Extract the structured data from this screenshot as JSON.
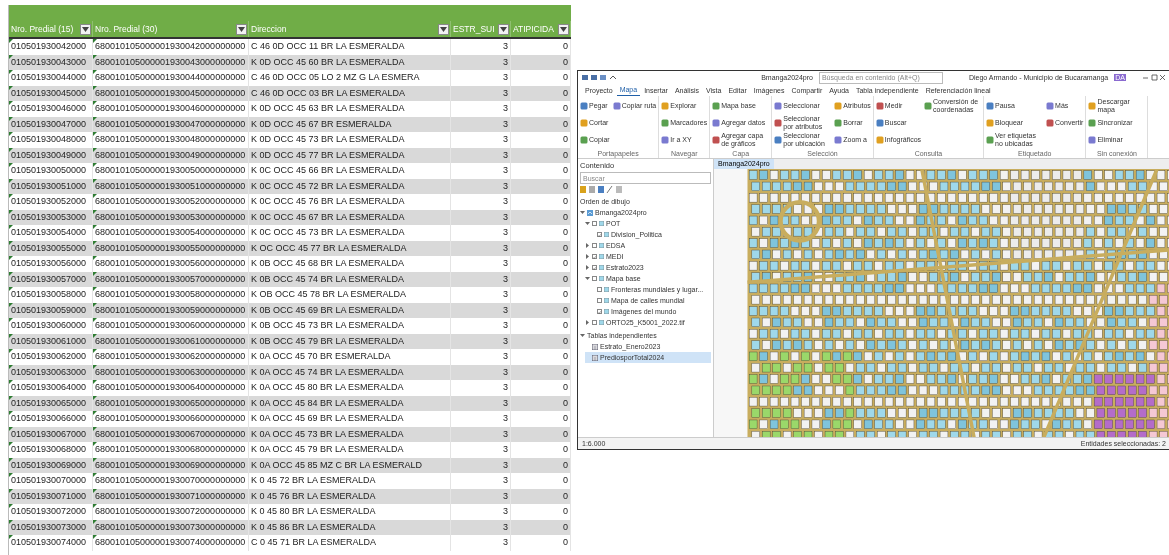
{
  "sheet": {
    "columns": [
      {
        "label": "Nro. Predial (15)"
      },
      {
        "label": "Nro. Predial (30)"
      },
      {
        "label": "Direccion"
      },
      {
        "label": "ESTR_SUI"
      },
      {
        "label": "ATIPICIDA"
      }
    ],
    "rows": [
      {
        "cells": [
          "010501930042000",
          "680010105000001930042000000000",
          "C 46 0D OCC 11 BR LA ESMERALDA",
          "3",
          "0"
        ]
      },
      {
        "cells": [
          "010501930043000",
          "680010105000001930043000000000",
          "K 0D OCC 45 60 BR LA ESMERALDA",
          "3",
          "0"
        ]
      },
      {
        "cells": [
          "010501930044000",
          "680010105000001930044000000000",
          "C 46 0D OCC 05 LO 2 MZ G LA ESMERA",
          "3",
          "0"
        ]
      },
      {
        "cells": [
          "010501930045000",
          "680010105000001930045000000000",
          "C 46 0D OCC 03 BR LA ESMERALDA",
          "3",
          "0"
        ]
      },
      {
        "cells": [
          "010501930046000",
          "680010105000001930046000000000",
          "K 0D OCC 45 63 BR LA ESMERALDA",
          "3",
          "0"
        ]
      },
      {
        "cells": [
          "010501930047000",
          "680010105000001930047000000000",
          "K 0D OCC 45 67 BR ESMERALDA",
          "3",
          "0"
        ]
      },
      {
        "cells": [
          "010501930048000",
          "680010105000001930048000000000",
          "K 0D OCC 45 73 BR LA ESMERALDA",
          "3",
          "0"
        ]
      },
      {
        "cells": [
          "010501930049000",
          "680010105000001930049000000000",
          "K 0D OCC 45 77 BR LA ESMERALDA",
          "3",
          "0"
        ]
      },
      {
        "cells": [
          "010501930050000",
          "680010105000001930050000000000",
          "K 0C OCC 45 66 BR LA ESMERALDA",
          "3",
          "0"
        ]
      },
      {
        "cells": [
          "010501930051000",
          "680010105000001930051000000000",
          "K 0C OCC 45 72 BR LA ESMERALDA",
          "3",
          "0"
        ]
      },
      {
        "cells": [
          "010501930052000",
          "680010105000001930052000000000",
          "K 0C OCC 45 76 BR LA ESMERALDA",
          "3",
          "0"
        ]
      },
      {
        "cells": [
          "010501930053000",
          "680010105000001930053000000000",
          "K 0C OCC 45 67 BR LA ESMERALDA",
          "3",
          "0"
        ]
      },
      {
        "cells": [
          "010501930054000",
          "680010105000001930054000000000",
          "K 0C OCC 45 73 BR LA ESMERALDA",
          "3",
          "0"
        ]
      },
      {
        "cells": [
          "010501930055000",
          "680010105000001930055000000000",
          "K OC OCC 45 77 BR LA ESMERALDA",
          "3",
          "0"
        ]
      },
      {
        "cells": [
          "010501930056000",
          "680010105000001930056000000000",
          "K 0B OCC 45 68 BR LA ESMERALDA",
          "3",
          "0"
        ]
      },
      {
        "cells": [
          "010501930057000",
          "680010105000001930057000000000",
          "K 0B OCC 45 74 BR LA ESMERALDA",
          "3",
          "0"
        ]
      },
      {
        "cells": [
          "010501930058000",
          "680010105000001930058000000000",
          "K OB OCC 45 78 BR LA ESMERALDA",
          "3",
          "0"
        ]
      },
      {
        "cells": [
          "010501930059000",
          "680010105000001930059000000000",
          "K 0B OCC 45 69 BR LA ESMERALDA",
          "3",
          "0"
        ]
      },
      {
        "cells": [
          "010501930060000",
          "680010105000001930060000000000",
          "K 0B OCC 45 73 BR LA ESMERALDA",
          "3",
          "0"
        ]
      },
      {
        "cells": [
          "010501930061000",
          "680010105000001930061000000000",
          "K 0B OCC 45 79 BR LA ESMERALDA",
          "3",
          "0"
        ]
      },
      {
        "cells": [
          "010501930062000",
          "680010105000001930062000000000",
          "K 0A OCC 45 70 BR ESMERALDA",
          "3",
          "0"
        ]
      },
      {
        "cells": [
          "010501930063000",
          "680010105000001930063000000000",
          "K 0A OCC 45 74 BR LA ESMERALDA",
          "3",
          "0"
        ]
      },
      {
        "cells": [
          "010501930064000",
          "680010105000001930064000000000",
          "K 0A OCC 45 80 BR LA ESMERALDA",
          "3",
          "0"
        ]
      },
      {
        "cells": [
          "010501930065000",
          "680010105000001930065000000000",
          "K 0A OCC 45 84 BR LA ESMERALDA",
          "3",
          "0"
        ]
      },
      {
        "cells": [
          "010501930066000",
          "680010105000001930066000000000",
          "K 0A OCC 45 69 BR LA ESMERALDA",
          "3",
          "0"
        ]
      },
      {
        "cells": [
          "010501930067000",
          "680010105000001930067000000000",
          "K 0A OCC 45 73 BR LA ESMERALDA",
          "3",
          "0"
        ]
      },
      {
        "cells": [
          "010501930068000",
          "680010105000001930068000000000",
          "K 0A OCC 45 79 BR LA ESMERALDA",
          "3",
          "0"
        ]
      },
      {
        "cells": [
          "010501930069000",
          "680010105000001930069000000000",
          "K 0A OCC 45 85 MZ C BR LA ESMERALD",
          "3",
          "0"
        ]
      },
      {
        "cells": [
          "010501930070000",
          "680010105000001930070000000000",
          "K 0 45 72 BR LA ESMERALDA",
          "3",
          "0"
        ]
      },
      {
        "cells": [
          "010501930071000",
          "680010105000001930071000000000",
          "K 0 45 76 BR LA ESMERALDA",
          "3",
          "0"
        ]
      },
      {
        "cells": [
          "010501930072000",
          "680010105000001930072000000000",
          "K 0 45 80 BR LA ESMERALDA",
          "3",
          "0"
        ]
      },
      {
        "cells": [
          "010501930073000",
          "680010105000001930073000000000",
          "K 0 45 86 BR LA ESMERALDA",
          "3",
          "0"
        ]
      },
      {
        "cells": [
          "010501930074000",
          "680010105000001930074000000000",
          "C 0 45 71 BR LA ESMERALDA",
          "3",
          "0"
        ]
      }
    ]
  },
  "gis_window": {
    "title": "Bmanga2024pro",
    "search_placeholder": "Búsqueda en contenido (Alt+Q)",
    "user": "Diego Armando - Municipio de Bucaramanga",
    "avatar": "DA",
    "ribbon_groups": [
      {
        "label": "Portapapeles",
        "items": [
          "Pegar",
          "Cortar",
          "Copiar",
          "Copiar ruta"
        ]
      },
      {
        "label": "Navegar",
        "items": [
          "Explorar",
          "Marcadores",
          "Ir a XY"
        ]
      },
      {
        "label": "Capa",
        "items": [
          "Mapa base",
          "Agregar datos",
          "Agregar capa de gráficos"
        ]
      },
      {
        "label": "Selección",
        "items": [
          "Seleccionar",
          "Seleccionar por atributos",
          "Seleccionar por ubicación",
          "Atributos",
          "Borrar",
          "Zoom a"
        ]
      },
      {
        "label": "Consulta",
        "items": [
          "Medir",
          "Buscar",
          "Infográficos",
          "Conversión de coordenadas"
        ]
      },
      {
        "label": "Etiquetado",
        "items": [
          "Pausa",
          "Bloquear",
          "Ver etiquetas no ubicadas",
          "Más",
          "Convertir"
        ]
      },
      {
        "label": "Sin conexión",
        "items": [
          "Descargar mapa",
          "Sincronizar",
          "Eliminar"
        ]
      }
    ],
    "tabs": [
      {
        "label": "Proyecto",
        "selected": false
      },
      {
        "label": "Mapa",
        "selected": true
      },
      {
        "label": "Insertar",
        "selected": false
      },
      {
        "label": "Análisis",
        "selected": false
      },
      {
        "label": "Vista",
        "selected": false
      },
      {
        "label": "Editar",
        "selected": false
      },
      {
        "label": "Imágenes",
        "selected": false
      },
      {
        "label": "Compartir",
        "selected": false
      },
      {
        "label": "Ayuda",
        "selected": false
      },
      {
        "label": "Tabla independiente",
        "selected": false
      },
      {
        "label": "Referenciación lineal",
        "selected": false
      }
    ],
    "contents": {
      "title": "Contenido",
      "search_placeholder": "Buscar",
      "section": "Orden de dibujo",
      "tree": [
        {
          "kind": "map",
          "label": "Bmanga2024pro",
          "expanded": true,
          "children": [
            {
              "kind": "layer",
              "label": "POT",
              "checked": false,
              "expanded": true,
              "children": [
                {
                  "kind": "layer",
                  "label": "Division_Politica",
                  "checked": true
                }
              ]
            },
            {
              "kind": "layer",
              "label": "EDSA",
              "checked": false,
              "expanded": false
            },
            {
              "kind": "layer",
              "label": "MEDI",
              "checked": true,
              "expanded": false
            },
            {
              "kind": "layer",
              "label": "Estrato2023",
              "checked": true,
              "expanded": false
            },
            {
              "kind": "layer",
              "label": "Mapa base",
              "checked": false,
              "expanded": true,
              "children": [
                {
                  "kind": "layer",
                  "label": "Fronteras mundiales y lugar...",
                  "checked": false
                },
                {
                  "kind": "layer",
                  "label": "Mapa de calles mundial",
                  "checked": false
                },
                {
                  "kind": "layer",
                  "label": "Imágenes del mundo",
                  "checked": true
                }
              ]
            },
            {
              "kind": "layer",
              "label": "ORTO25_K5001_2022.tif",
              "checked": false,
              "expanded": false
            }
          ]
        },
        {
          "kind": "heading",
          "label": "Tablas independientes",
          "expanded": true,
          "children": [
            {
              "kind": "table",
              "label": "Estrato_Enero2023",
              "selected": false
            },
            {
              "kind": "table",
              "label": "PrediosporTotal2024",
              "selected": true
            }
          ]
        }
      ]
    },
    "map_tab": "Bmanga2024pro",
    "status": {
      "scale": "1:6.000",
      "selected_info": "Entidades seleccionadas: 2"
    }
  }
}
